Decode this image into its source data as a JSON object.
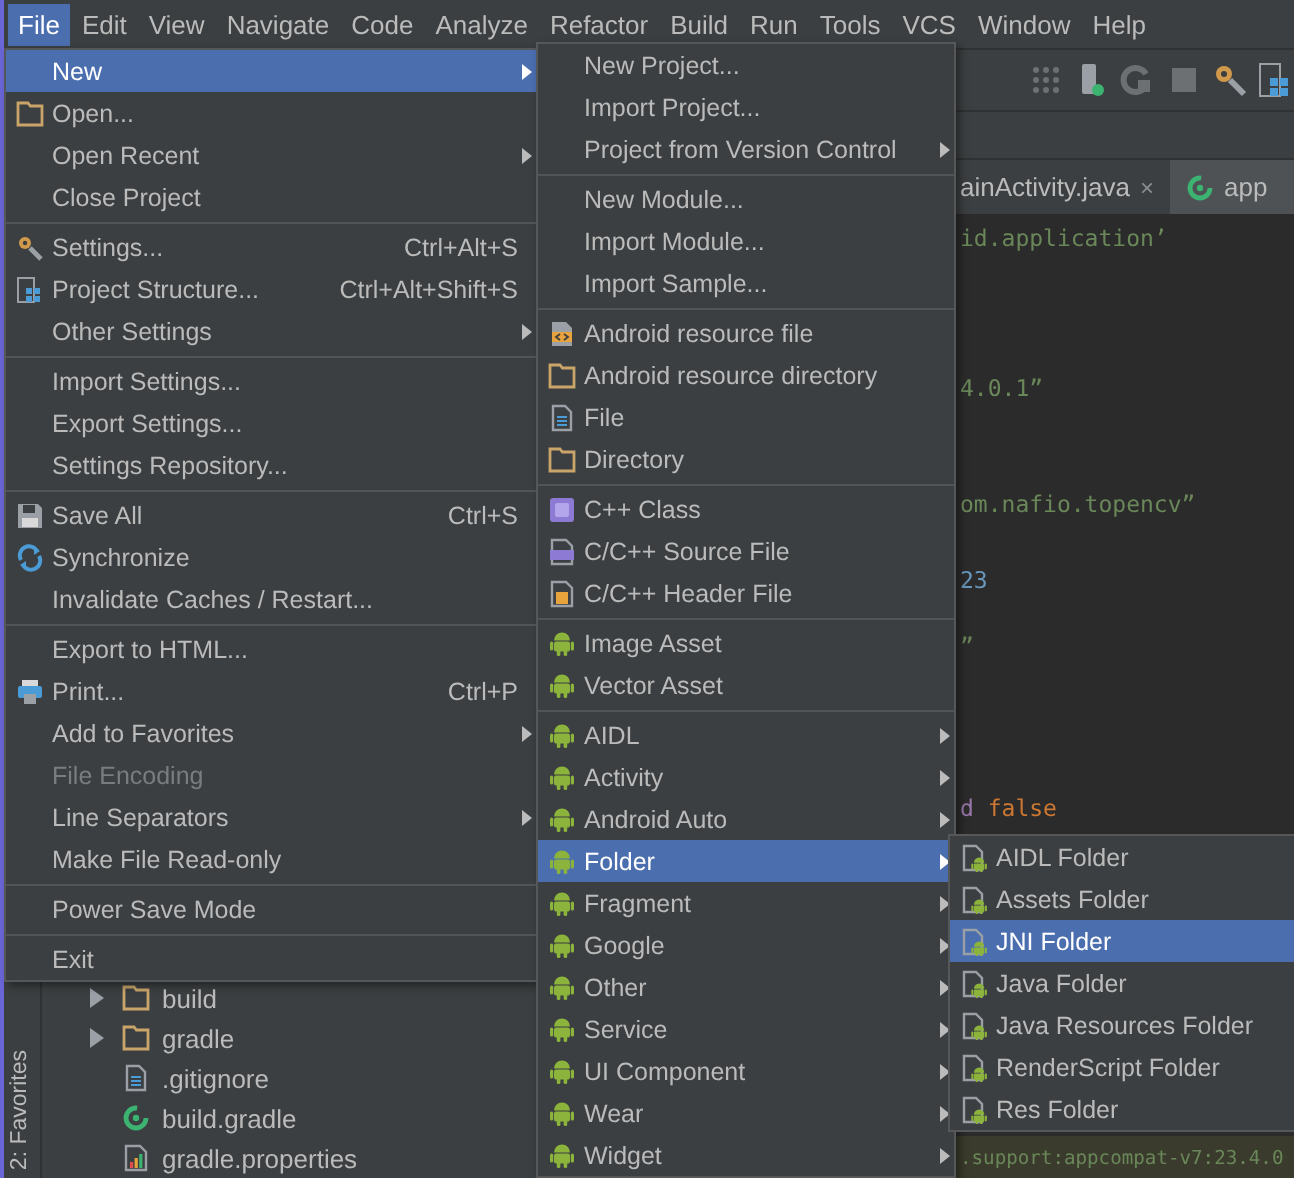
{
  "menu_bar": [
    {
      "label": "File",
      "selected": true
    },
    {
      "label": "Edit",
      "selected": false
    },
    {
      "label": "View",
      "selected": false
    },
    {
      "label": "Navigate",
      "selected": false
    },
    {
      "label": "Code",
      "selected": false
    },
    {
      "label": "Analyze",
      "selected": false
    },
    {
      "label": "Refactor",
      "selected": false
    },
    {
      "label": "Build",
      "selected": false
    },
    {
      "label": "Run",
      "selected": false
    },
    {
      "label": "Tools",
      "selected": false
    },
    {
      "label": "VCS",
      "selected": false
    },
    {
      "label": "Window",
      "selected": false
    },
    {
      "label": "Help",
      "selected": false
    }
  ],
  "editor_tabs": [
    {
      "label": "ainActivity.java",
      "selected": false,
      "close": "×"
    },
    {
      "label": "app",
      "selected": true
    }
  ],
  "editor_lines": [
    [
      {
        "text": "id.application’",
        "kind": "string"
      }
    ],
    [
      {
        "text": "4.0.1”",
        "kind": "string"
      }
    ],
    [
      {
        "text": "om.nafio.topencv”",
        "kind": "string"
      }
    ],
    [
      {
        "text": "23",
        "kind": "number"
      }
    ],
    [
      {
        "text": "”",
        "kind": "string"
      }
    ],
    [
      {
        "text": "d ",
        "kind": "param"
      },
      {
        "text": "false",
        "kind": "keyword"
      }
    ],
    [
      {
        "text": ".support:appcompat-v7:23.4.0",
        "kind": "string"
      }
    ]
  ],
  "side_strip": {
    "label": "2: Favorites"
  },
  "project_tree": [
    {
      "label": "build",
      "kind": "folder"
    },
    {
      "label": "gradle",
      "kind": "folder"
    },
    {
      "label": ".gitignore",
      "kind": "file"
    },
    {
      "label": "build.gradle",
      "kind": "gradle"
    },
    {
      "label": "gradle.properties",
      "kind": "properties"
    }
  ],
  "file_menu": {
    "groups": [
      [
        {
          "label": "New",
          "kind": "none",
          "submenu": true,
          "selected": true,
          "disabled": false
        },
        {
          "label": "Open...",
          "kind": "folder",
          "submenu": false,
          "selected": false,
          "disabled": false
        },
        {
          "label": "Open Recent",
          "kind": "none",
          "submenu": true,
          "selected": false,
          "disabled": false
        },
        {
          "label": "Close Project",
          "kind": "none",
          "submenu": false,
          "selected": false,
          "disabled": false
        }
      ],
      [
        {
          "label": "Settings...",
          "kind": "settings",
          "shortcut": "Ctrl+Alt+S",
          "submenu": false,
          "selected": false,
          "disabled": false
        },
        {
          "label": "Project Structure...",
          "kind": "structure",
          "shortcut": "Ctrl+Alt+Shift+S",
          "submenu": false,
          "selected": false,
          "disabled": false
        },
        {
          "label": "Other Settings",
          "kind": "none",
          "submenu": true,
          "selected": false,
          "disabled": false
        }
      ],
      [
        {
          "label": "Import Settings...",
          "kind": "none",
          "submenu": false,
          "selected": false,
          "disabled": false
        },
        {
          "label": "Export Settings...",
          "kind": "none",
          "submenu": false,
          "selected": false,
          "disabled": false
        },
        {
          "label": "Settings Repository...",
          "kind": "none",
          "submenu": false,
          "selected": false,
          "disabled": false
        }
      ],
      [
        {
          "label": "Save All",
          "kind": "save",
          "shortcut": "Ctrl+S",
          "submenu": false,
          "selected": false,
          "disabled": false
        },
        {
          "label": "Synchronize",
          "kind": "sync",
          "submenu": false,
          "selected": false,
          "disabled": false
        },
        {
          "label": "Invalidate Caches / Restart...",
          "kind": "none",
          "submenu": false,
          "selected": false,
          "disabled": false
        }
      ],
      [
        {
          "label": "Export to HTML...",
          "kind": "none",
          "submenu": false,
          "selected": false,
          "disabled": false
        },
        {
          "label": "Print...",
          "kind": "print",
          "shortcut": "Ctrl+P",
          "submenu": false,
          "selected": false,
          "disabled": false
        },
        {
          "label": "Add to Favorites",
          "kind": "none",
          "submenu": true,
          "selected": false,
          "disabled": false
        },
        {
          "label": "File Encoding",
          "kind": "none",
          "submenu": false,
          "selected": false,
          "disabled": true
        },
        {
          "label": "Line Separators",
          "kind": "none",
          "submenu": true,
          "selected": false,
          "disabled": false
        },
        {
          "label": "Make File Read-only",
          "kind": "none",
          "submenu": false,
          "selected": false,
          "disabled": false
        }
      ],
      [
        {
          "label": "Power Save Mode",
          "kind": "none",
          "submenu": false,
          "selected": false,
          "disabled": false
        }
      ],
      [
        {
          "label": "Exit",
          "kind": "none",
          "submenu": false,
          "selected": false,
          "disabled": false
        }
      ]
    ]
  },
  "new_menu": {
    "groups": [
      [
        {
          "label": "New Project...",
          "kind": "none",
          "submenu": false,
          "selected": false
        },
        {
          "label": "Import Project...",
          "kind": "none",
          "submenu": false,
          "selected": false
        },
        {
          "label": "Project from Version Control",
          "kind": "none",
          "submenu": true,
          "selected": false
        }
      ],
      [
        {
          "label": "New Module...",
          "kind": "none",
          "submenu": false,
          "selected": false
        },
        {
          "label": "Import Module...",
          "kind": "none",
          "submenu": false,
          "selected": false
        },
        {
          "label": "Import Sample...",
          "kind": "none",
          "submenu": false,
          "selected": false
        }
      ],
      [
        {
          "label": "Android resource file",
          "kind": "resource",
          "submenu": false,
          "selected": false
        },
        {
          "label": "Android resource directory",
          "kind": "folder",
          "submenu": false,
          "selected": false
        },
        {
          "label": "File",
          "kind": "file",
          "submenu": false,
          "selected": false
        },
        {
          "label": "Directory",
          "kind": "folder",
          "submenu": false,
          "selected": false
        }
      ],
      [
        {
          "label": "C++ Class",
          "kind": "class",
          "submenu": false,
          "selected": false
        },
        {
          "label": "C/C++ Source File",
          "kind": "source",
          "submenu": false,
          "selected": false
        },
        {
          "label": "C/C++ Header File",
          "kind": "header",
          "submenu": false,
          "selected": false
        }
      ],
      [
        {
          "label": "Image Asset",
          "kind": "android",
          "submenu": false,
          "selected": false
        },
        {
          "label": "Vector Asset",
          "kind": "android",
          "submenu": false,
          "selected": false
        }
      ],
      [
        {
          "label": "AIDL",
          "kind": "android",
          "submenu": true,
          "selected": false
        },
        {
          "label": "Activity",
          "kind": "android",
          "submenu": true,
          "selected": false
        },
        {
          "label": "Android Auto",
          "kind": "android",
          "submenu": true,
          "selected": false
        },
        {
          "label": "Folder",
          "kind": "android",
          "submenu": true,
          "selected": true
        },
        {
          "label": "Fragment",
          "kind": "android",
          "submenu": true,
          "selected": false
        },
        {
          "label": "Google",
          "kind": "android",
          "submenu": true,
          "selected": false
        },
        {
          "label": "Other",
          "kind": "android",
          "submenu": true,
          "selected": false
        },
        {
          "label": "Service",
          "kind": "android",
          "submenu": true,
          "selected": false
        },
        {
          "label": "UI Component",
          "kind": "android",
          "submenu": true,
          "selected": false
        },
        {
          "label": "Wear",
          "kind": "android",
          "submenu": true,
          "selected": false
        },
        {
          "label": "Widget",
          "kind": "android",
          "submenu": true,
          "selected": false
        }
      ]
    ]
  },
  "folder_menu": {
    "groups": [
      [
        {
          "label": "AIDL Folder",
          "kind": "android-file",
          "selected": false
        },
        {
          "label": "Assets Folder",
          "kind": "android-file",
          "selected": false
        },
        {
          "label": "JNI Folder",
          "kind": "android-file",
          "selected": true
        },
        {
          "label": "Java Folder",
          "kind": "android-file",
          "selected": false
        },
        {
          "label": "Java Resources Folder",
          "kind": "android-file",
          "selected": false
        },
        {
          "label": "RenderScript Folder",
          "kind": "android-file",
          "selected": false
        },
        {
          "label": "Res Folder",
          "kind": "android-file",
          "selected": false
        }
      ]
    ]
  }
}
